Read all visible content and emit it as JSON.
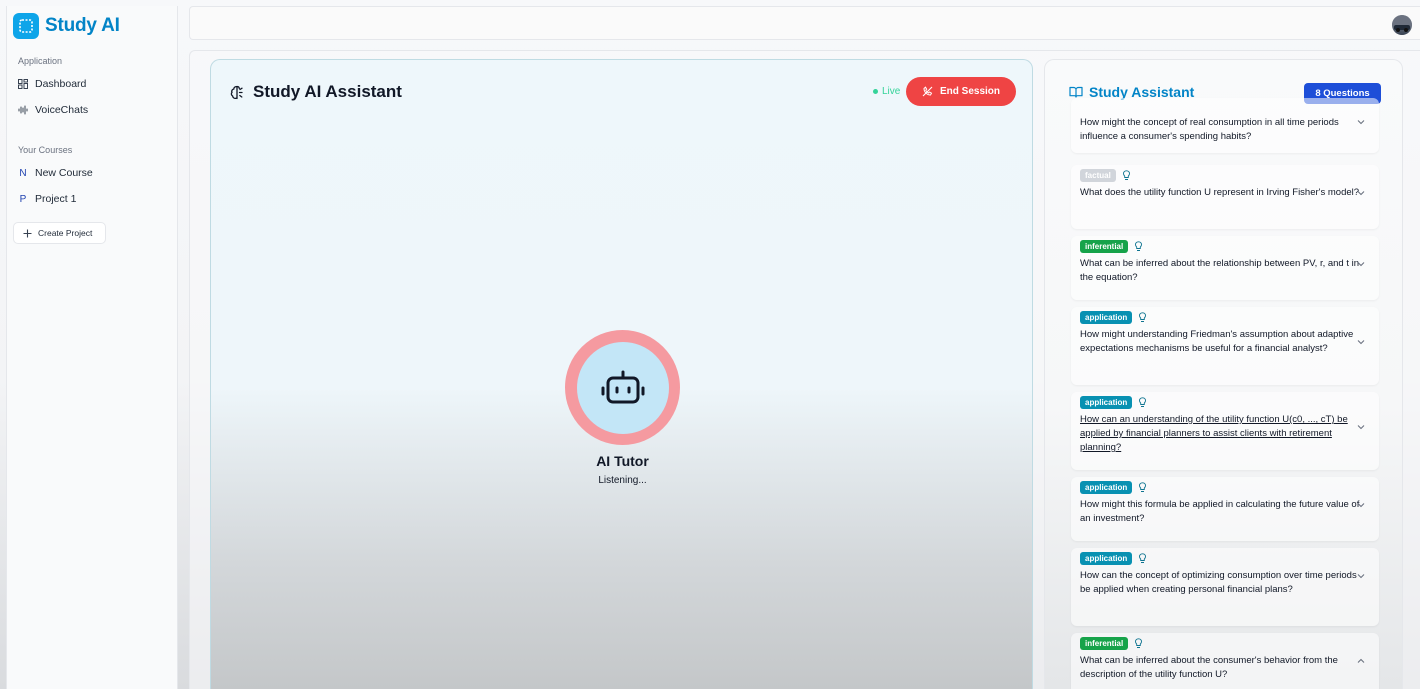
{
  "app": {
    "name": "Study AI"
  },
  "sidebar": {
    "section_application": "Application",
    "nav": [
      {
        "label": "Dashboard"
      },
      {
        "label": "VoiceChats"
      }
    ],
    "section_courses": "Your Courses",
    "courses": [
      {
        "letter": "N",
        "label": "New Course"
      },
      {
        "letter": "P",
        "label": "Project 1"
      }
    ],
    "create_label": "Create Project"
  },
  "assistant": {
    "title": "Study AI Assistant",
    "live_label": "Live",
    "end_label": "End Session",
    "bot_name": "AI Tutor",
    "bot_status": "Listening..."
  },
  "panel": {
    "title": "Study Assistant",
    "badge": "8 Questions",
    "questions": [
      {
        "tag": "",
        "text": "How might the concept of real consumption in all time periods influence a consumer's spending habits?",
        "chevron": "down"
      },
      {
        "tag": "factual",
        "text": "What does the utility function U represent in Irving Fisher's model?",
        "chevron": "down"
      },
      {
        "tag": "inferential",
        "text": "What can be inferred about the relationship between PV, r, and t in the equation?",
        "chevron": "down"
      },
      {
        "tag": "application",
        "text": "How might understanding Friedman's assumption about adaptive expectations mechanisms be useful for a financial analyst?",
        "chevron": "down"
      },
      {
        "tag": "application",
        "text": "How can an understanding of the utility function U(c0, ..., cT) be applied by financial planners to assist clients with retirement planning?",
        "chevron": "down"
      },
      {
        "tag": "application",
        "text": "How might this formula be applied in calculating the future value of an investment?",
        "chevron": "down"
      },
      {
        "tag": "application",
        "text": "How can the concept of optimizing consumption over time periods be applied when creating personal financial plans?",
        "chevron": "down"
      },
      {
        "tag": "inferential",
        "text": "What can be inferred about the consumer's behavior from the description of the utility function U?",
        "chevron": "up"
      }
    ]
  }
}
